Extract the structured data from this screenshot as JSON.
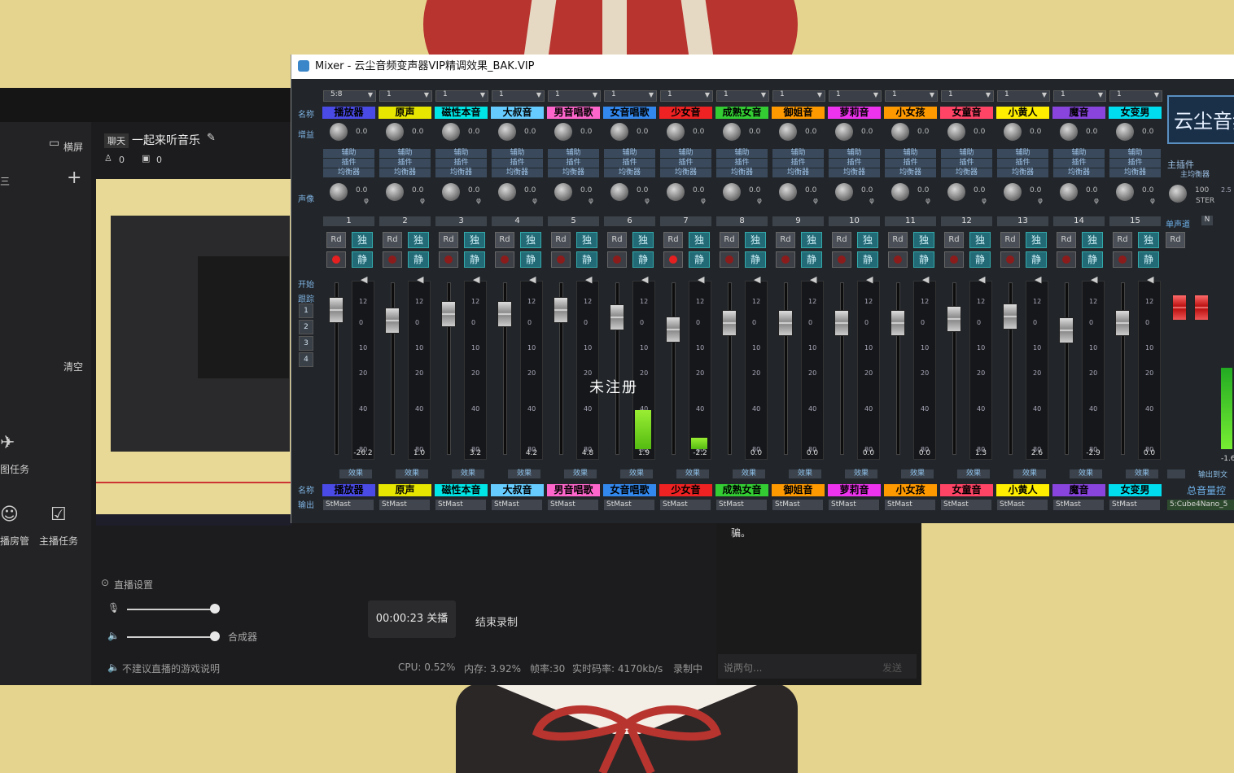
{
  "colors": {
    "accent": "#236a77",
    "record": "#cc2222",
    "title_bg": "#ffffff",
    "mixer_bg": "#22262b"
  },
  "mixer": {
    "title": "Mixer - 云尘音频变声器VIP精调效果_BAK.VIP",
    "logo": "云尘音频",
    "row_labels": {
      "name": "名称",
      "gain": "增益",
      "pan": "声像",
      "start": "开始",
      "track": "跟踪",
      "name_bottom": "名称",
      "output": "输出"
    },
    "side_numbers": [
      "1",
      "2",
      "3",
      "4"
    ],
    "strip_labels": {
      "aux": "辅助",
      "plugin": "插件",
      "eq": "均衡器",
      "fx": "效果"
    },
    "master": {
      "plugin": "主插件",
      "eq": "主均衡器",
      "pan_val": "100",
      "stereo": "STER",
      "num_label": "单声道",
      "n_btn": "N",
      "rd": "Rd",
      "scale_top": "2.5",
      "bottom_val": "-1.6",
      "fx": "输出到文",
      "name_bottom": "总音量控制",
      "output": "5:Cube4Nano_5"
    },
    "channels": [
      {
        "num": "1",
        "top": "5:8",
        "name": "播放器",
        "color": "#4a4ae6",
        "gain": "0.0",
        "pan": "0.0",
        "meter_val": "-26.2",
        "output": "StMast",
        "rec_active": true
      },
      {
        "num": "2",
        "top": "1",
        "name": "原声",
        "color": "#e6e600",
        "gain": "0.0",
        "pan": "0.0",
        "meter_val": "1.0",
        "output": "StMast",
        "rec_active": false
      },
      {
        "num": "3",
        "top": "1",
        "name": "磁性本音",
        "color": "#00e6e6",
        "gain": "0.0",
        "pan": "0.0",
        "meter_val": "3.2",
        "output": "StMast",
        "rec_active": false
      },
      {
        "num": "4",
        "top": "1",
        "name": "大叔音",
        "color": "#66ccff",
        "gain": "0.0",
        "pan": "0.0",
        "meter_val": "4.2",
        "output": "StMast",
        "rec_active": false
      },
      {
        "num": "5",
        "top": "1",
        "name": "男音唱歌",
        "color": "#ff66cc",
        "gain": "0.0",
        "pan": "0.0",
        "meter_val": "4.8",
        "output": "StMast",
        "rec_active": false
      },
      {
        "num": "6",
        "top": "1",
        "name": "女音唱歌",
        "color": "#3388ee",
        "gain": "0.0",
        "pan": "0.0",
        "meter_val": "1.9",
        "output": "StMast",
        "rec_active": false
      },
      {
        "num": "7",
        "top": "1",
        "name": "少女音",
        "color": "#ee2222",
        "gain": "0.0",
        "pan": "0.0",
        "meter_val": "-2.2",
        "output": "StMast",
        "rec_active": true
      },
      {
        "num": "8",
        "top": "1",
        "name": "成熟女音",
        "color": "#33cc33",
        "gain": "0.0",
        "pan": "0.0",
        "meter_val": "0.0",
        "output": "StMast",
        "rec_active": false
      },
      {
        "num": "9",
        "top": "1",
        "name": "御姐音",
        "color": "#ff9900",
        "gain": "0.0",
        "pan": "0.0",
        "meter_val": "0.0",
        "output": "StMast",
        "rec_active": false
      },
      {
        "num": "10",
        "top": "1",
        "name": "萝莉音",
        "color": "#ee33ee",
        "gain": "0.0",
        "pan": "0.0",
        "meter_val": "0.0",
        "output": "StMast",
        "rec_active": false
      },
      {
        "num": "11",
        "top": "1",
        "name": "小女孩",
        "color": "#ff9900",
        "gain": "0.0",
        "pan": "0.0",
        "meter_val": "0.0",
        "output": "StMast",
        "rec_active": false
      },
      {
        "num": "12",
        "top": "1",
        "name": "女童音",
        "color": "#ff4466",
        "gain": "0.0",
        "pan": "0.0",
        "meter_val": "1.3",
        "output": "StMast",
        "rec_active": false
      },
      {
        "num": "13",
        "top": "1",
        "name": "小黄人",
        "color": "#ffee00",
        "gain": "0.0",
        "pan": "0.0",
        "meter_val": "2.6",
        "output": "StMast",
        "rec_active": false
      },
      {
        "num": "14",
        "top": "1",
        "name": "魔音",
        "color": "#8844dd",
        "gain": "0.0",
        "pan": "0.0",
        "meter_val": "-2.9",
        "output": "StMast",
        "rec_active": false
      },
      {
        "num": "15",
        "top": "1",
        "name": "女变男",
        "color": "#00ddee",
        "gain": "0.0",
        "pan": "0.0",
        "meter_val": "0.0",
        "output": "StMast",
        "rec_active": false
      }
    ],
    "meter_scale": [
      "12",
      "0",
      "10",
      "20",
      "40",
      "80"
    ],
    "rd": "Rd",
    "solo": "独",
    "mute": "静"
  },
  "watermark": "未注册",
  "app": {
    "landscape": "横屏",
    "chat_tab": "聊天",
    "room_title": "一起来听音乐",
    "viewers": "0",
    "gifts": "0",
    "clear": "清空",
    "task_label": "图任务",
    "room_manage": "播房管",
    "host_task": "主播任务",
    "live_settings": "直播设置",
    "synth": "合成器",
    "timer": "00:00:23 关播",
    "end_record": "结束录制",
    "status": {
      "game_tip": "不建议直播的游戏说明",
      "cpu": "CPU: 0.52%",
      "mem": "内存: 3.92%",
      "fps": "帧率:30",
      "bitrate": "实时码率: 4170kb/s",
      "recording": "录制中"
    },
    "chat_placeholder": "说两句...",
    "send": "发送",
    "chat_msg": "骗。"
  }
}
